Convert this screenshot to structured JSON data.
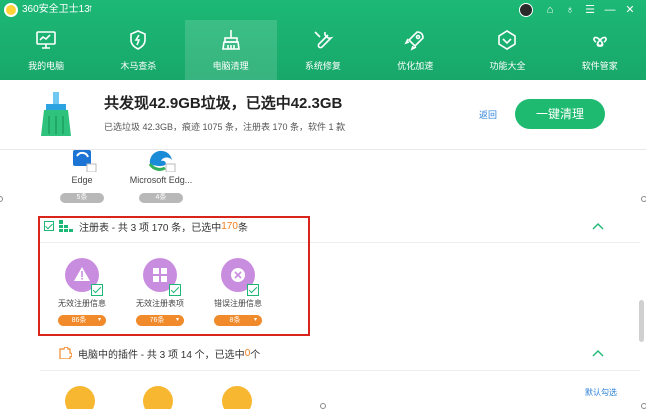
{
  "titlebar": {
    "title": "360安全卫士13",
    "up_arrow": "↑",
    "icons": [
      "avatar-icon",
      "skin-icon",
      "shirt-icon",
      "menu-icon",
      "minimize-icon",
      "close-icon"
    ],
    "glyphs": {
      "skin": "⌂",
      "shirt": "♁",
      "menu": "☰",
      "minimize": "—",
      "close": "✕"
    }
  },
  "nav": {
    "items": [
      {
        "label": "我的电脑",
        "icon": "monitor-icon"
      },
      {
        "label": "木马查杀",
        "icon": "shield-icon"
      },
      {
        "label": "电脑清理",
        "icon": "broom-icon",
        "active": true
      },
      {
        "label": "系统修复",
        "icon": "wrench-icon"
      },
      {
        "label": "优化加速",
        "icon": "rocket-icon"
      },
      {
        "label": "功能大全",
        "icon": "diamond-icon"
      },
      {
        "label": "软件管家",
        "icon": "clover-icon"
      }
    ]
  },
  "summary": {
    "title": "共发现42.9GB垃圾，已选中42.3GB",
    "detail": "已选垃圾 42.3GB，痕迹 1075 条，注册表 170 条，软件 1 款",
    "back_label": "返回",
    "clean_label": "一键清理"
  },
  "browsers": [
    {
      "name": "Edge",
      "count": "5条"
    },
    {
      "name": "Microsoft Edg...",
      "count": "4条"
    }
  ],
  "registry": {
    "header_prefix": "注册表 - 共 3 项 170 条，已选中 ",
    "header_count": "170",
    "header_suffix": " 条",
    "items": [
      {
        "name": "无效注册信息",
        "count": "86条",
        "icon": "warning-icon"
      },
      {
        "name": "无效注册表项",
        "count": "76条",
        "icon": "grid-icon"
      },
      {
        "name": "错误注册信息",
        "count": "8条",
        "icon": "error-icon"
      }
    ]
  },
  "plugins": {
    "header_prefix": "电脑中的插件 - 共 3 项 14 个，已选中 ",
    "header_count": "0",
    "header_suffix": " 个",
    "default_check_label": "默认勾选"
  },
  "colors": {
    "brand_green": "#1db876",
    "orange": "#f08a2a",
    "purple": "#c98de0",
    "highlight_red": "#d9241c",
    "link_blue": "#2a7fd9"
  }
}
